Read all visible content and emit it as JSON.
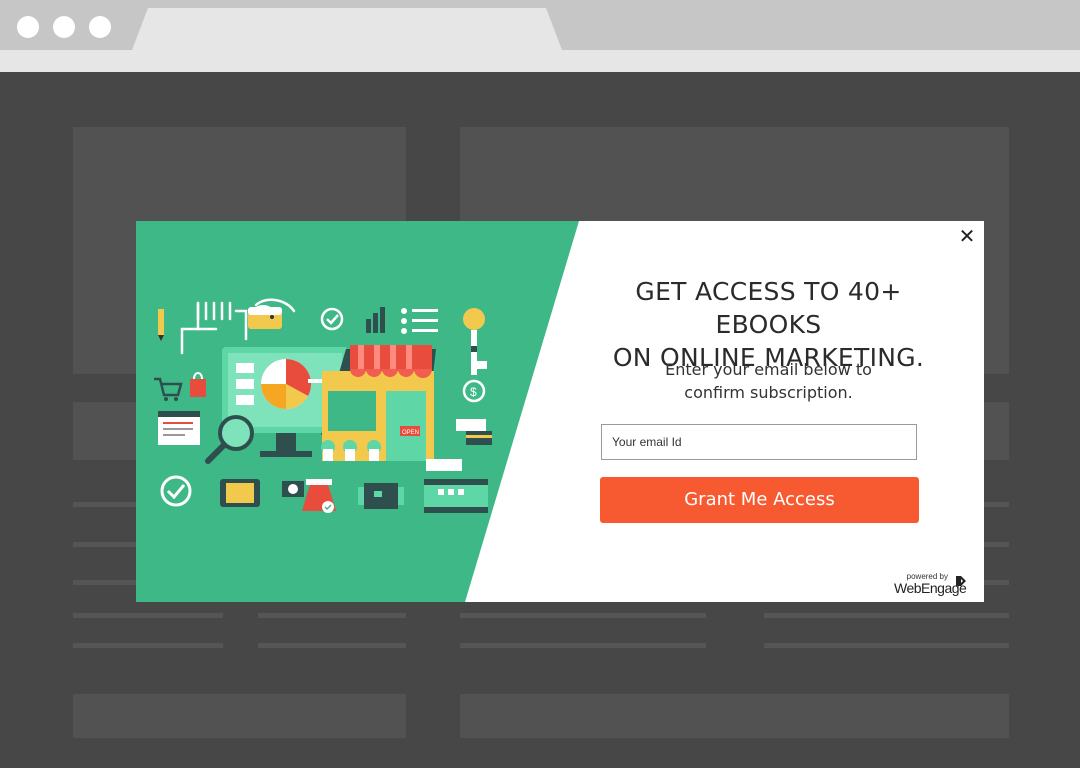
{
  "browser": {
    "window_controls": [
      "close-dot",
      "minimize-dot",
      "zoom-dot"
    ],
    "tab_title": ""
  },
  "modal": {
    "headline_line1": "GET ACCESS TO 40+ EBOOKS",
    "headline_line2": "ON ONLINE MARKETING.",
    "subline_line1": "Enter your email below to",
    "subline_line2": "confirm subscription.",
    "email": {
      "placeholder": "Your email Id",
      "value": ""
    },
    "cta_label": "Grant Me Access",
    "close_icon": "close-icon",
    "powered_by": "powered by",
    "brand_name": "WebEngage"
  },
  "colors": {
    "art_bg": "#3eb887",
    "cta_bg": "#f75a31",
    "page_bg": "#474747"
  }
}
